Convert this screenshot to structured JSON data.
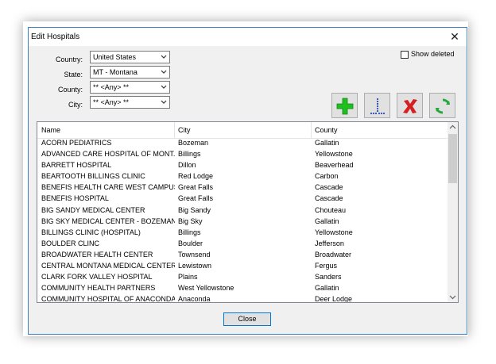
{
  "window": {
    "title": "Edit Hospitals",
    "close_glyph": "✕"
  },
  "filters": {
    "country": {
      "label": "Country:",
      "value": "United States"
    },
    "state": {
      "label": "State:",
      "value": "MT - Montana"
    },
    "county": {
      "label": "County:",
      "value": "** <Any> **"
    },
    "city": {
      "label": "City:",
      "value": "** <Any> **"
    }
  },
  "show_deleted": {
    "label": "Show deleted",
    "checked": false
  },
  "toolbar": {
    "add": {
      "icon": "green-plus-icon"
    },
    "edit": {
      "icon": "blue-dotted-i-icon"
    },
    "delete": {
      "icon": "red-x-icon"
    },
    "refresh": {
      "icon": "green-refresh-icon"
    }
  },
  "table": {
    "columns": [
      "Name",
      "City",
      "County"
    ],
    "rows": [
      [
        "ACORN PEDIATRICS",
        "Bozeman",
        "Gallatin"
      ],
      [
        "ADVANCED CARE HOSPITAL OF MONT...",
        "Billings",
        "Yellowstone"
      ],
      [
        "BARRETT HOSPITAL",
        "Dillon",
        "Beaverhead"
      ],
      [
        "BEARTOOTH BILLINGS CLINIC",
        "Red Lodge",
        "Carbon"
      ],
      [
        "BENEFIS HEALTH CARE WEST CAMPUS",
        "Great Falls",
        "Cascade"
      ],
      [
        "BENEFIS HOSPITAL",
        "Great Falls",
        "Cascade"
      ],
      [
        "BIG SANDY MEDICAL CENTER",
        "Big Sandy",
        "Chouteau"
      ],
      [
        "BIG SKY MEDICAL CENTER - BOZEMAN ...",
        "Big Sky",
        "Gallatin"
      ],
      [
        "BILLINGS CLINIC (HOSPITAL)",
        "Billings",
        "Yellowstone"
      ],
      [
        "BOULDER CLINC",
        "Boulder",
        "Jefferson"
      ],
      [
        "BROADWATER HEALTH CENTER",
        "Townsend",
        "Broadwater"
      ],
      [
        "CENTRAL MONTANA MEDICAL CENTER",
        "Lewistown",
        "Fergus"
      ],
      [
        "CLARK FORK VALLEY HOSPITAL",
        "Plains",
        "Sanders"
      ],
      [
        "COMMUNITY HEALTH PARTNERS",
        "West Yellowstone",
        "Gallatin"
      ],
      [
        "COMMUNITY HOSPITAL OF ANACONDA",
        "Anaconda",
        "Deer Lodge"
      ]
    ]
  },
  "footer": {
    "close_label": "Close"
  },
  "colors": {
    "accent": "#0078d7",
    "border": "#3f7fbf",
    "add": "#1fbf1f",
    "delete": "#d42020",
    "refresh": "#22a83a",
    "edit": "#2a4fb0"
  }
}
